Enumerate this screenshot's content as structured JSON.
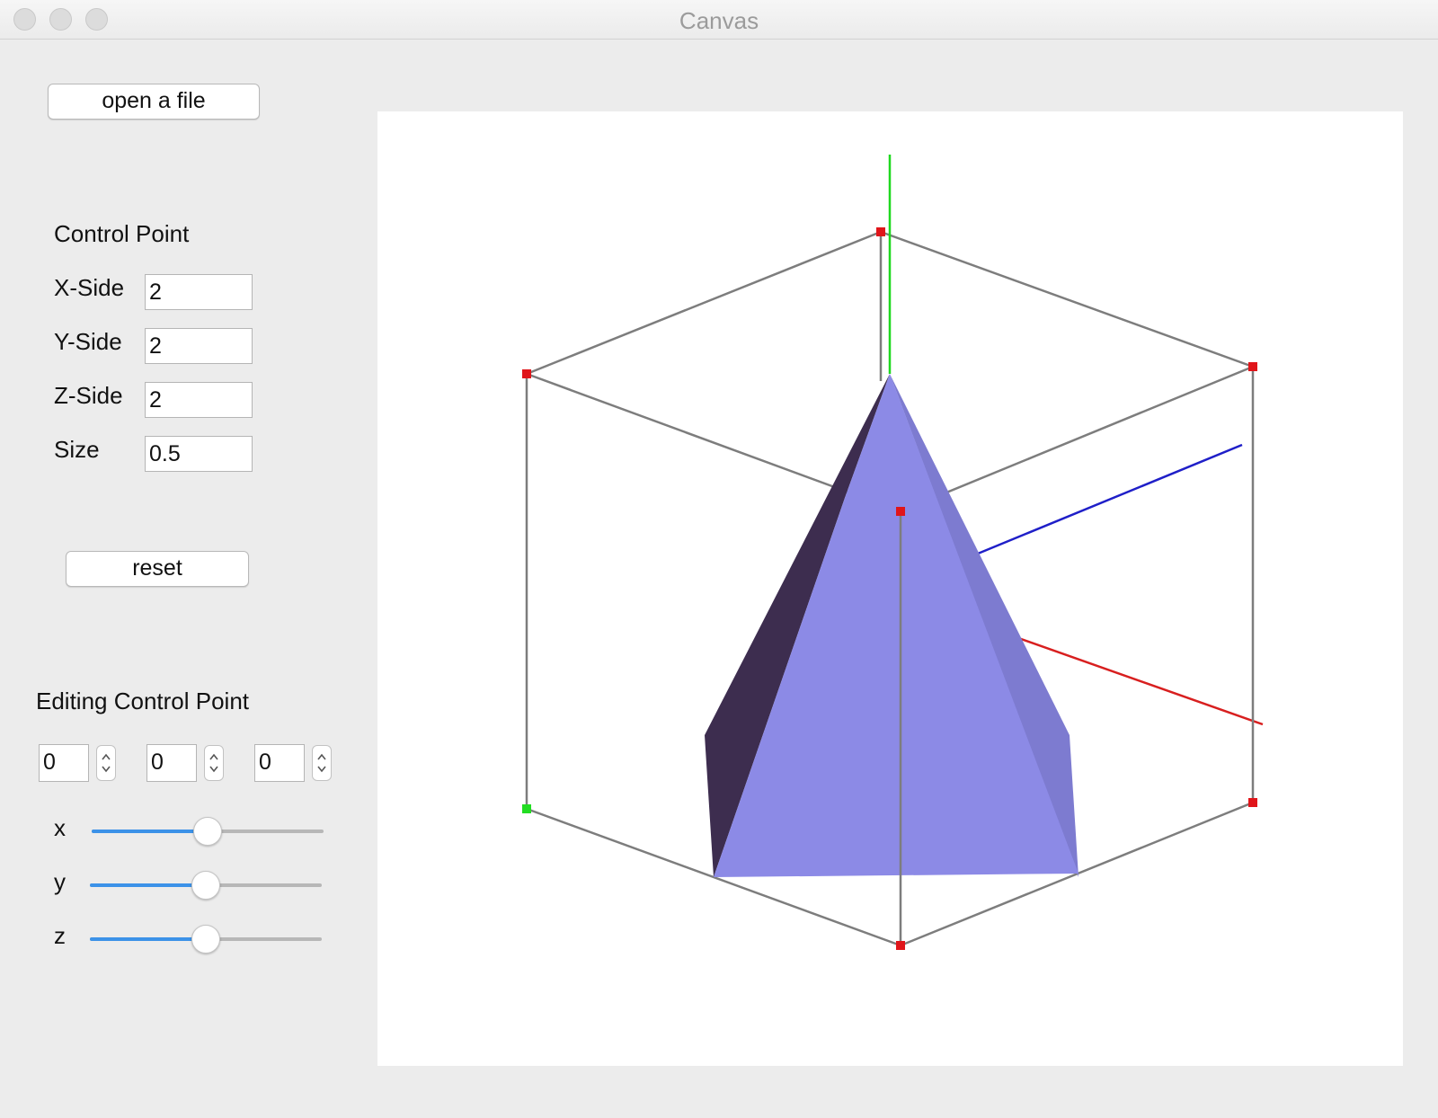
{
  "window": {
    "title": "Canvas"
  },
  "toolbar": {
    "open_label": "open a file"
  },
  "control_point": {
    "heading": "Control Point",
    "fields": [
      {
        "label": "X-Side",
        "value": "2"
      },
      {
        "label": "Y-Side",
        "value": "2"
      },
      {
        "label": "Z-Side",
        "value": "2"
      },
      {
        "label": "Size",
        "value": "0.5"
      }
    ],
    "reset_label": "reset"
  },
  "editing": {
    "heading": "Editing Control Point",
    "spinners": [
      "0",
      "0",
      "0"
    ],
    "sliders": [
      {
        "label": "x",
        "value_fraction": 0.5
      },
      {
        "label": "y",
        "value_fraction": 0.5
      },
      {
        "label": "z",
        "value_fraction": 0.5
      }
    ]
  },
  "viewport": {
    "colors": {
      "axis_x": "#d81f1f",
      "axis_y": "#1fd81f",
      "axis_z": "#1f1fc8",
      "box_edges": "#7d7d7d",
      "control_point": "#e0151a",
      "selected_control_point": "#22dd22",
      "solid_front": "#8c8ae6",
      "solid_side_dark": "#3d2d4f",
      "solid_side_right": "#7d7bd0"
    }
  }
}
